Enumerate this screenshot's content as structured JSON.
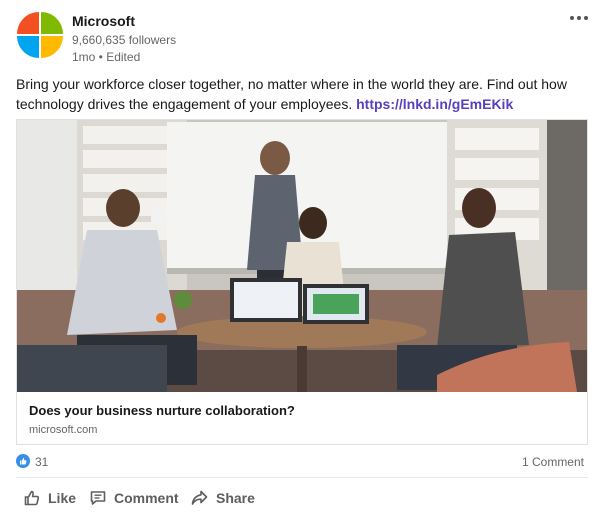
{
  "post": {
    "actor_name": "Microsoft",
    "followers": "9,660,635 followers",
    "meta": "1mo • Edited",
    "commentary_text": "Bring your workforce closer together, no matter where in the world they are. Find out how technology drives the engagement of your employees. ",
    "commentary_link": "https://lnkd.in/gEmEKik"
  },
  "article": {
    "title": "Does your business nurture collaboration?",
    "domain": "microsoft.com"
  },
  "social": {
    "reactions": "31",
    "comments": "1 Comment"
  },
  "actions": {
    "like": "Like",
    "comment": "Comment",
    "share": "Share"
  },
  "colors": {
    "logo_red": "#f25022",
    "logo_green": "#7fba00",
    "logo_blue": "#00a4ef",
    "logo_yellow": "#ffb900",
    "link": "#5a3fbd",
    "like_blue": "#378fe9"
  },
  "icons": {
    "more": "more-horizontal-icon",
    "like": "thumbs-up-icon",
    "comment": "comment-icon",
    "share": "share-arrow-icon"
  }
}
